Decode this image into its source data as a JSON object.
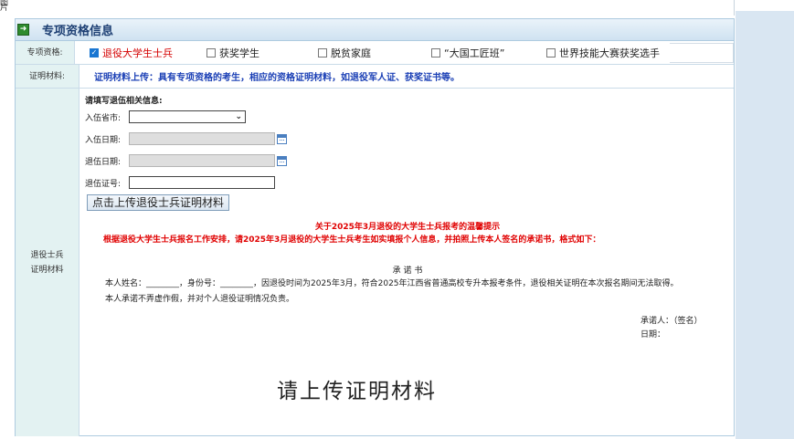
{
  "top_fragment": "图片",
  "panel": {
    "title": "专项资格信息",
    "icon": "arrow-right-icon"
  },
  "qualification": {
    "label": "专项资格:",
    "options": [
      {
        "label": "退役大学生士兵",
        "checked": true
      },
      {
        "label": "获奖学生",
        "checked": false
      },
      {
        "label": "脱贫家庭",
        "checked": false
      },
      {
        "label": "“大国工匠班”",
        "checked": false
      },
      {
        "label": "世界技能大赛获奖选手",
        "checked": false
      }
    ]
  },
  "material": {
    "label": "证明材料:",
    "text": "证明材料上传：具有专项资格的考生，相应的资格证明材料，如退役军人证、获奖证书等。"
  },
  "veteran": {
    "label_line1": "退役士兵",
    "label_line2": "证明材料",
    "section_title": "请填写退伍相关信息:",
    "enlist_city_label": "入伍省市:",
    "enlist_city_value": "",
    "enlist_date_label": "入伍日期:",
    "discharge_date_label": "退伍日期:",
    "discharge_cert_label": "退伍证号:",
    "upload_button": "点击上传退役士兵证明材料",
    "notice_title": "关于2025年3月退役的大学生士兵报考的温馨提示",
    "notice_body": "根据退役大学生士兵报名工作安排，请2025年3月退役的大学生士兵考生如实填报个人信息，并拍照上传本人签名的承诺书，格式如下：",
    "letter_title": "承 诺 书",
    "letter_line1": "本人姓名：________，身份号：________，因退役时间为2025年3月，符合2025年江西省普通高校专升本报考条件，退役相关证明在本次报名期间无法取得。",
    "letter_line2": "本人承诺不弄虚作假，并对个人退役证明情况负责。",
    "signer": "承诺人：（签名）",
    "date": "日期：",
    "upload_placeholder": "请上传证明材料"
  }
}
